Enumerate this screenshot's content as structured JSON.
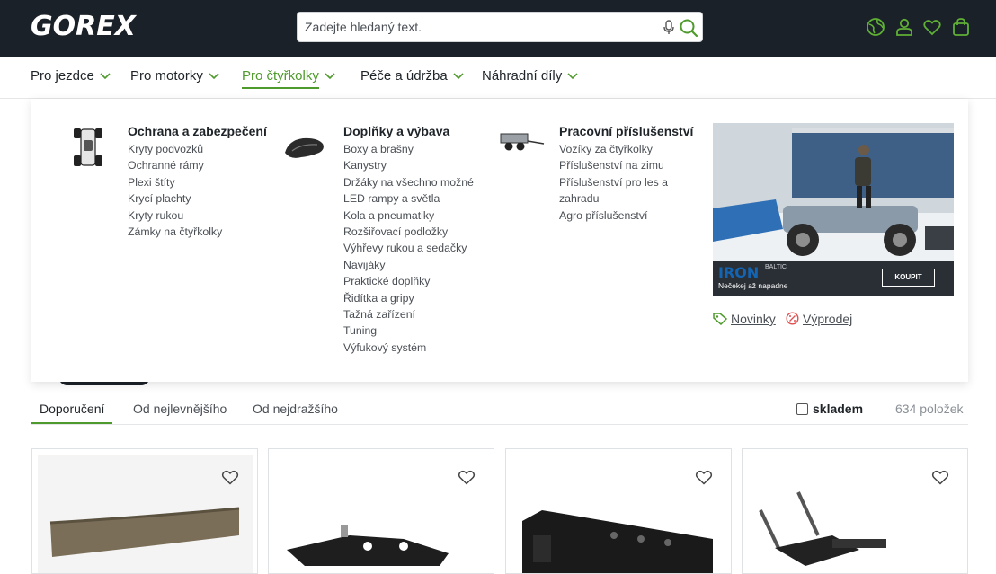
{
  "header": {
    "logo": "GOREX",
    "search_placeholder": "Zadejte hledaný text.",
    "icons": [
      "mic-icon",
      "search-icon",
      "globe-icon",
      "user-icon",
      "heart-icon",
      "bag-icon"
    ]
  },
  "nav": {
    "items": [
      {
        "label": "Pro jezdce"
      },
      {
        "label": "Pro motorky"
      },
      {
        "label": "Pro čtyřkolky",
        "active": true
      },
      {
        "label": "Péče a údržba"
      },
      {
        "label": "Náhradní díly"
      }
    ]
  },
  "mega": {
    "columns": [
      {
        "title": "Ochrana a zabezpečení",
        "icon": "atv-body-icon",
        "links": [
          "Kryty podvozků",
          "Ochranné rámy",
          "Plexi štíty",
          "Krycí plachty",
          "Kryty rukou",
          "Zámky na čtyřkolky"
        ]
      },
      {
        "title": "Doplňky a výbava",
        "icon": "atv-seat-icon",
        "links": [
          "Boxy a brašny",
          "Kanystry",
          "Držáky na všechno možné",
          "LED rampy a světla",
          "Kola a pneumatiky",
          "Rozšiřovací podložky",
          "Výhřevy rukou a sedačky",
          "Navijáky",
          "Praktické doplňky",
          "Řidítka a gripy",
          "Tažná zařízení",
          "Tuning",
          "Výfukový systém"
        ]
      },
      {
        "title": "Pracovní příslušenství",
        "icon": "atv-trailer-icon",
        "links": [
          "Vozíky za čtyřkolky",
          "Příslušenství na zimu",
          "Příslušenství pro les a zahradu",
          "Agro příslušenství"
        ]
      }
    ],
    "promo": {
      "brand": "IRON",
      "brand_sub": "BALTIC",
      "tagline": "Nečekej až napadne",
      "button": "KOUPIT"
    },
    "links": {
      "new": "Novinky",
      "sale": "Výprodej"
    }
  },
  "sort": {
    "tabs": [
      {
        "label": "Doporučení",
        "active": true
      },
      {
        "label": "Od nejlevnějšího"
      },
      {
        "label": "Od nejdražšího"
      }
    ],
    "stock_label": "skladem",
    "stock_checked": false,
    "count": "634 položek"
  },
  "products": [
    {
      "image": "plow-blade"
    },
    {
      "image": "mounting-plate"
    },
    {
      "image": "plow-frame"
    },
    {
      "image": "spring-mount"
    }
  ],
  "colors": {
    "header_bg": "#1b2128",
    "accent_green": "#4f9a2c",
    "text": "#1f2428",
    "muted": "#4a4f55"
  }
}
